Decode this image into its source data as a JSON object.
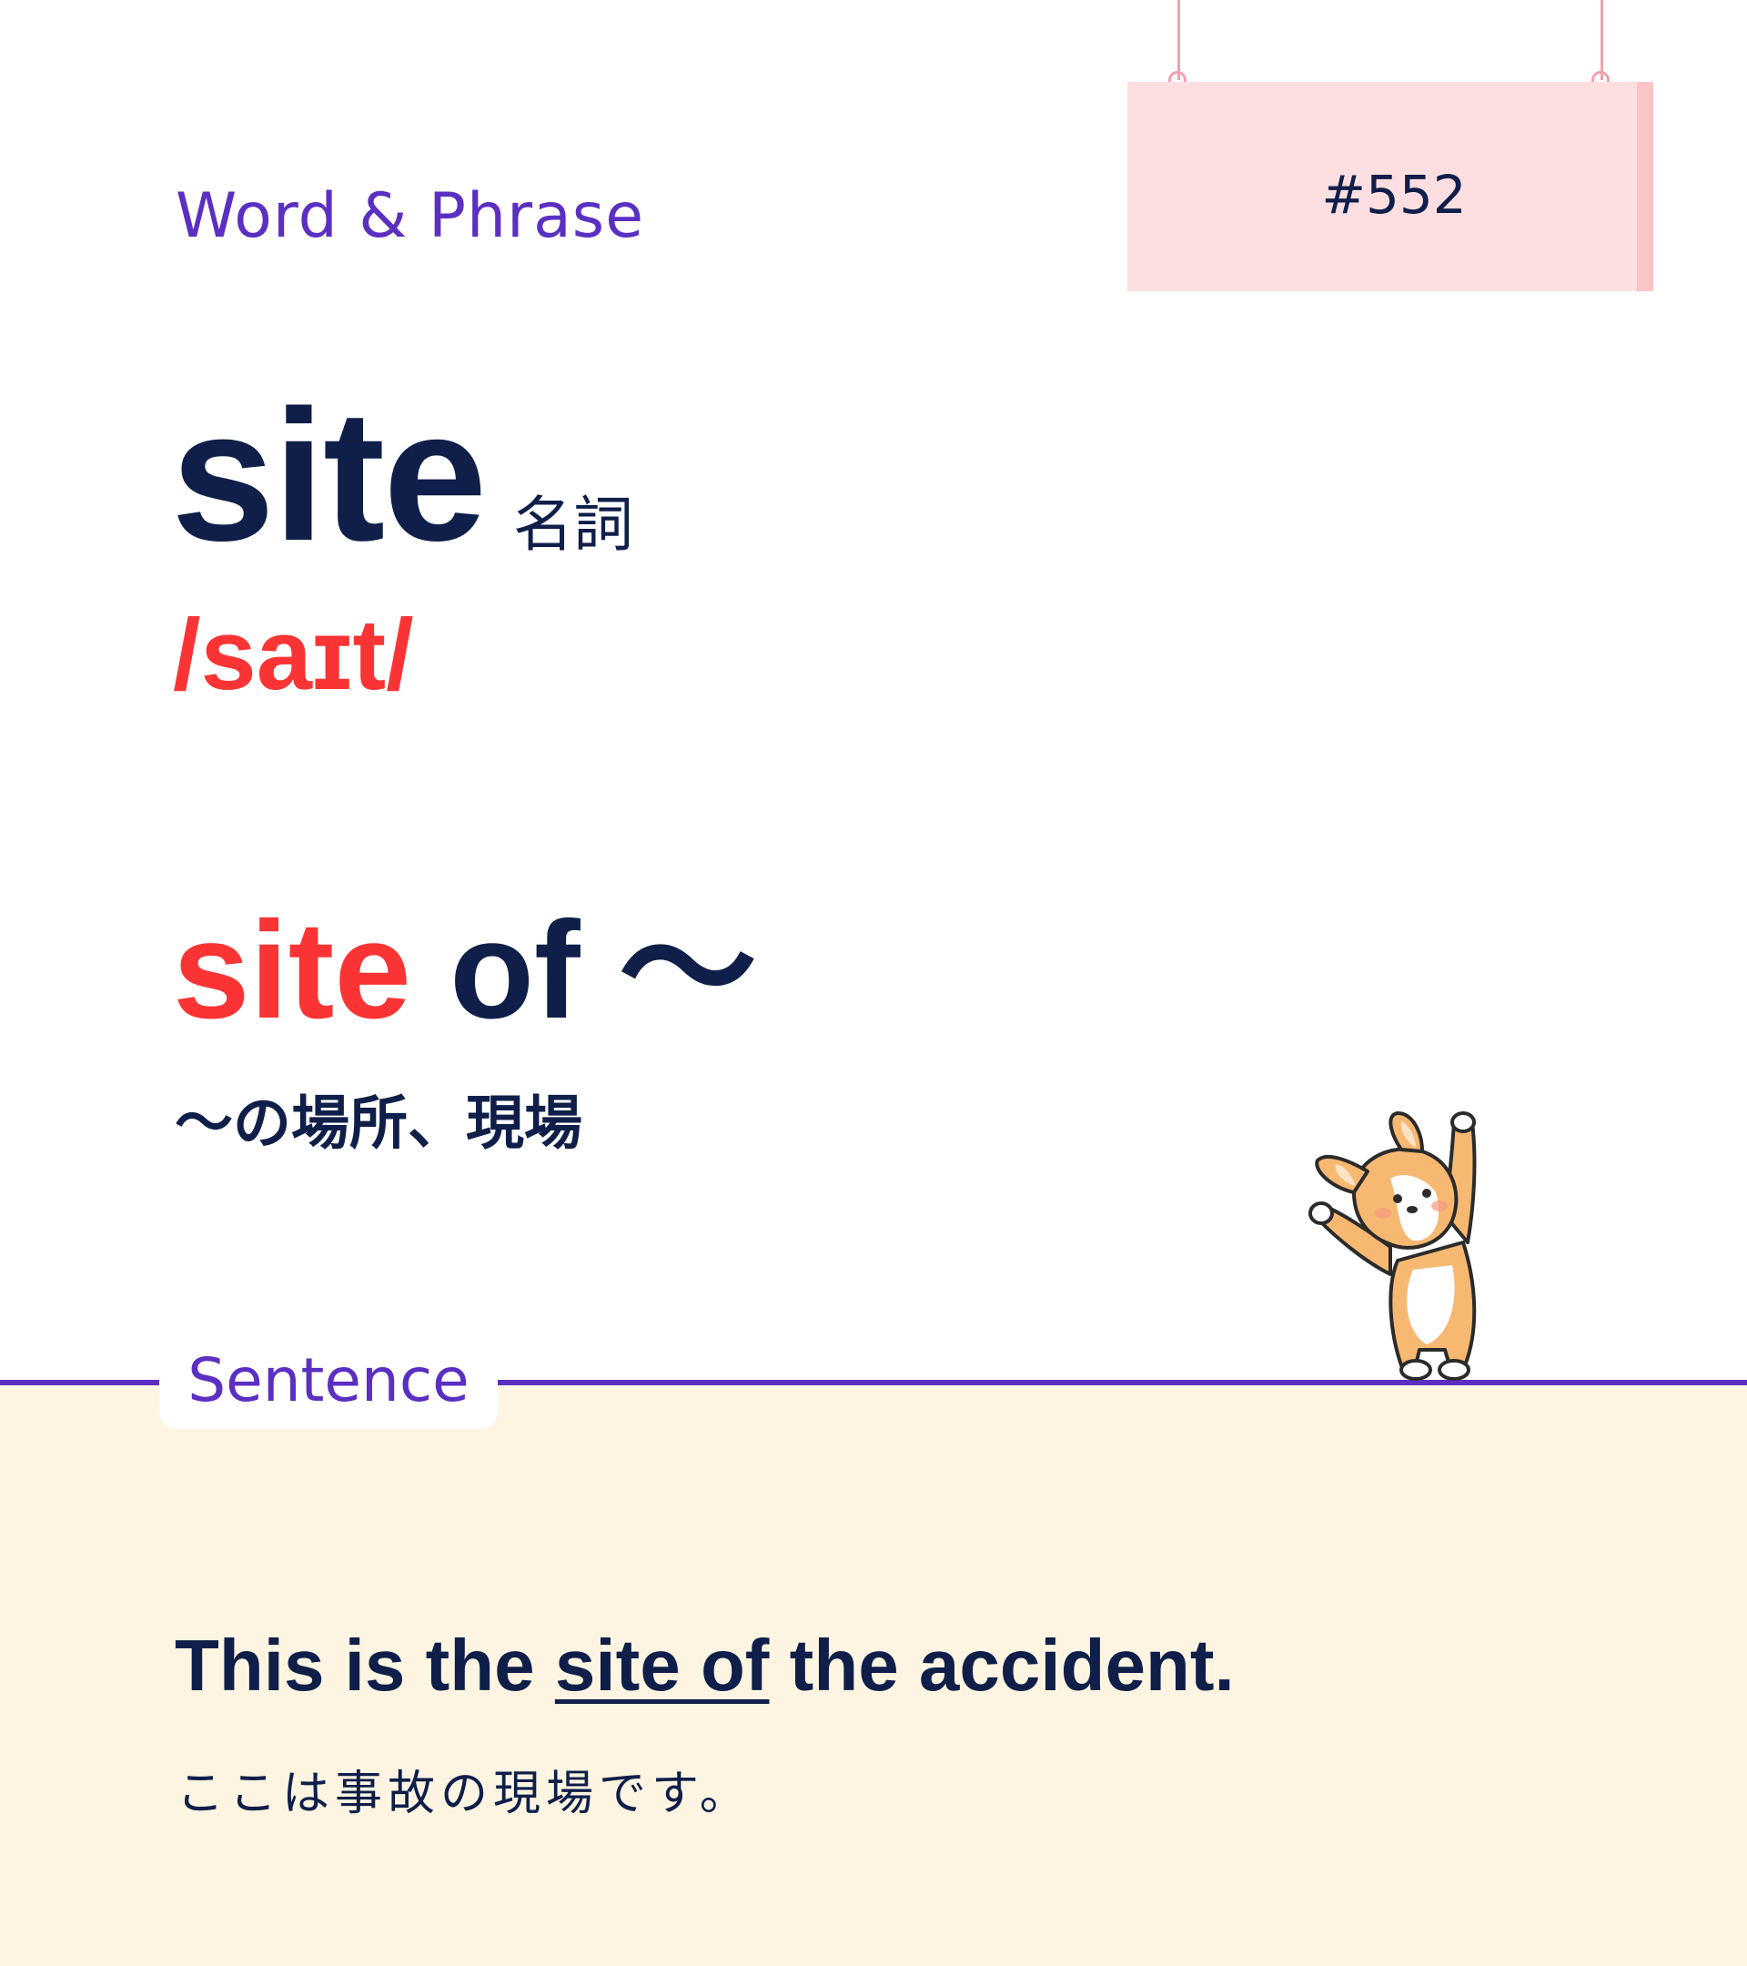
{
  "header": {
    "section_label": "Word & Phrase",
    "card_number": "#552"
  },
  "entry": {
    "headword": "site",
    "part_of_speech": "名詞",
    "pronunciation": "/saɪt/"
  },
  "phrase": {
    "key": "site",
    "rest": " of ～",
    "meaning": "～の場所、現場"
  },
  "sentence": {
    "label": "Sentence",
    "example_before": "This is the ",
    "example_highlight": "site of",
    "example_after": " the accident.",
    "translation": "ここは事故の現場です。"
  },
  "colors": {
    "navy": "#0f1f49",
    "red": "#fa3434",
    "purple": "#5b2fc2",
    "sign_pink": "#fddfe2",
    "panel_cream": "#fdf5e2"
  },
  "icons": {
    "mascot": "corgi-mascot-icon"
  }
}
